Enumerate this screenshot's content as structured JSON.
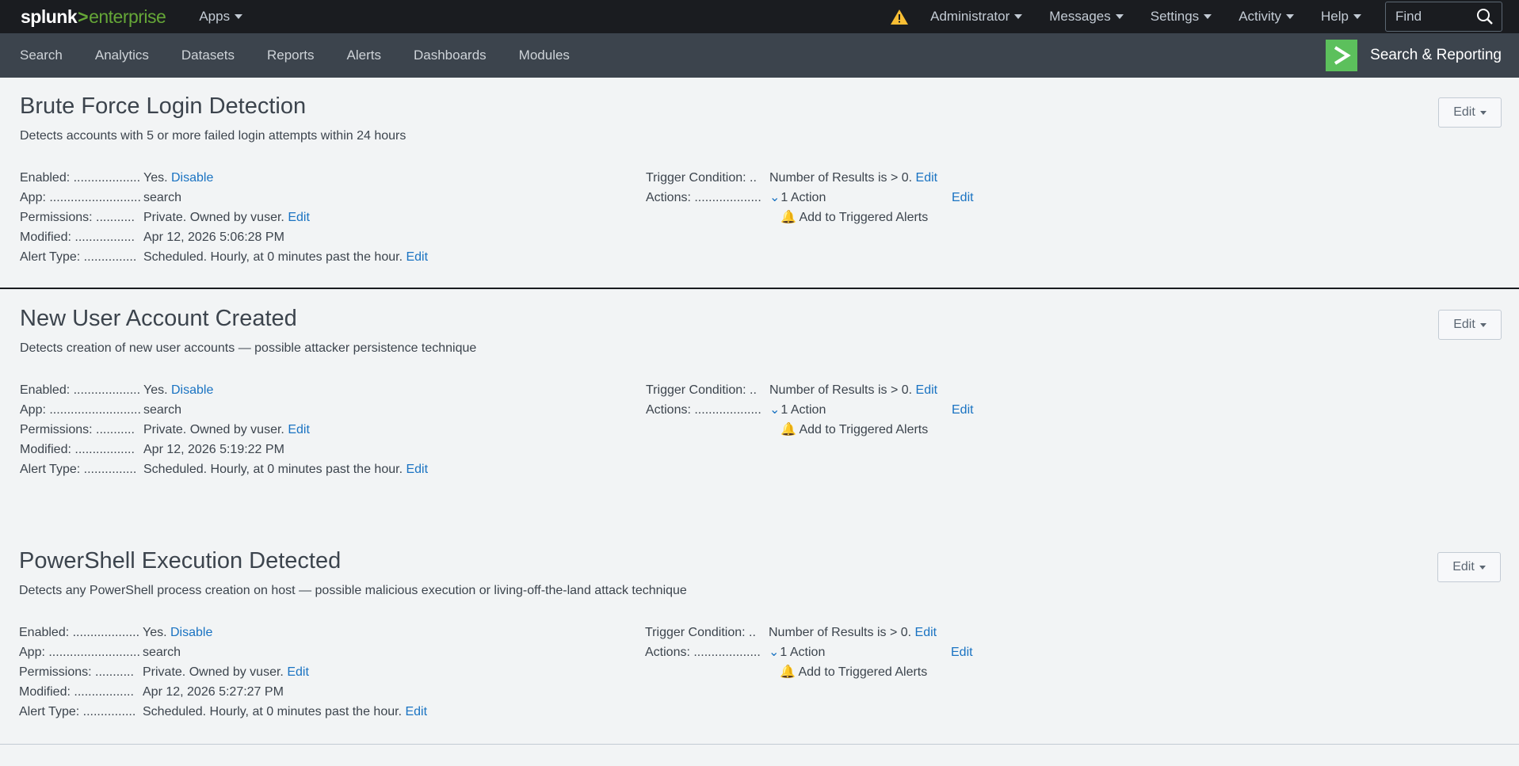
{
  "topbar": {
    "logo_part1": "splunk",
    "logo_part2": ">",
    "logo_part3": "enterprise",
    "apps_label": "Apps",
    "menu": [
      "Administrator",
      "Messages",
      "Settings",
      "Activity",
      "Help"
    ],
    "find_placeholder": "Find"
  },
  "appbar": {
    "nav": [
      "Search",
      "Analytics",
      "Datasets",
      "Reports",
      "Alerts",
      "Dashboards",
      "Modules"
    ],
    "app_name": "Search & Reporting"
  },
  "labels": {
    "enabled": "Enabled: ...................",
    "app": "App: ..........................",
    "permissions": "Permissions: ...........",
    "modified": "Modified: .................",
    "alert_type": "Alert Type: ...............",
    "trigger_condition": "Trigger Condition: ..",
    "actions": "Actions: ...................",
    "edit": "Edit",
    "disable": "Disable"
  },
  "alerts": [
    {
      "title": "Brute Force Login Detection",
      "description": "Detects accounts with 5 or more failed login attempts within 24 hours",
      "enabled": "Yes.",
      "app": "search",
      "permissions": "Private. Owned by vuser.",
      "modified": "Apr 12, 2026 5:06:28 PM",
      "alert_type": "Scheduled. Hourly, at 0 minutes past the hour.",
      "trigger_condition": "Number of Results is > 0.",
      "actions": "1 Action",
      "action_item": "Add to Triggered Alerts"
    },
    {
      "title": "New User Account Created",
      "description": "Detects creation of new user accounts — possible attacker persistence technique",
      "enabled": "Yes.",
      "app": "search",
      "permissions": "Private. Owned by vuser.",
      "modified": "Apr 12, 2026 5:19:22 PM",
      "alert_type": "Scheduled. Hourly, at 0 minutes past the hour.",
      "trigger_condition": "Number of Results is > 0.",
      "actions": "1 Action",
      "action_item": "Add to Triggered Alerts"
    },
    {
      "title": "PowerShell Execution Detected",
      "description": "Detects any PowerShell process creation on host — possible malicious execution or living-off-the-land attack technique",
      "enabled": "Yes.",
      "app": "search",
      "permissions": "Private. Owned by vuser.",
      "modified": "Apr 12, 2026 5:27:27 PM",
      "alert_type": "Scheduled. Hourly, at 0 minutes past the hour.",
      "trigger_condition": "Number of Results is > 0.",
      "actions": "1 Action",
      "action_item": "Add to Triggered Alerts"
    }
  ],
  "colors": {
    "topbar_bg": "#1a1c20",
    "appbar_bg": "#3c444d",
    "page_bg": "#f2f4f5",
    "link": "#1a73c2",
    "brand_green": "#65a637",
    "app_logo_green": "#5cc05c",
    "warning": "#f8be34"
  }
}
